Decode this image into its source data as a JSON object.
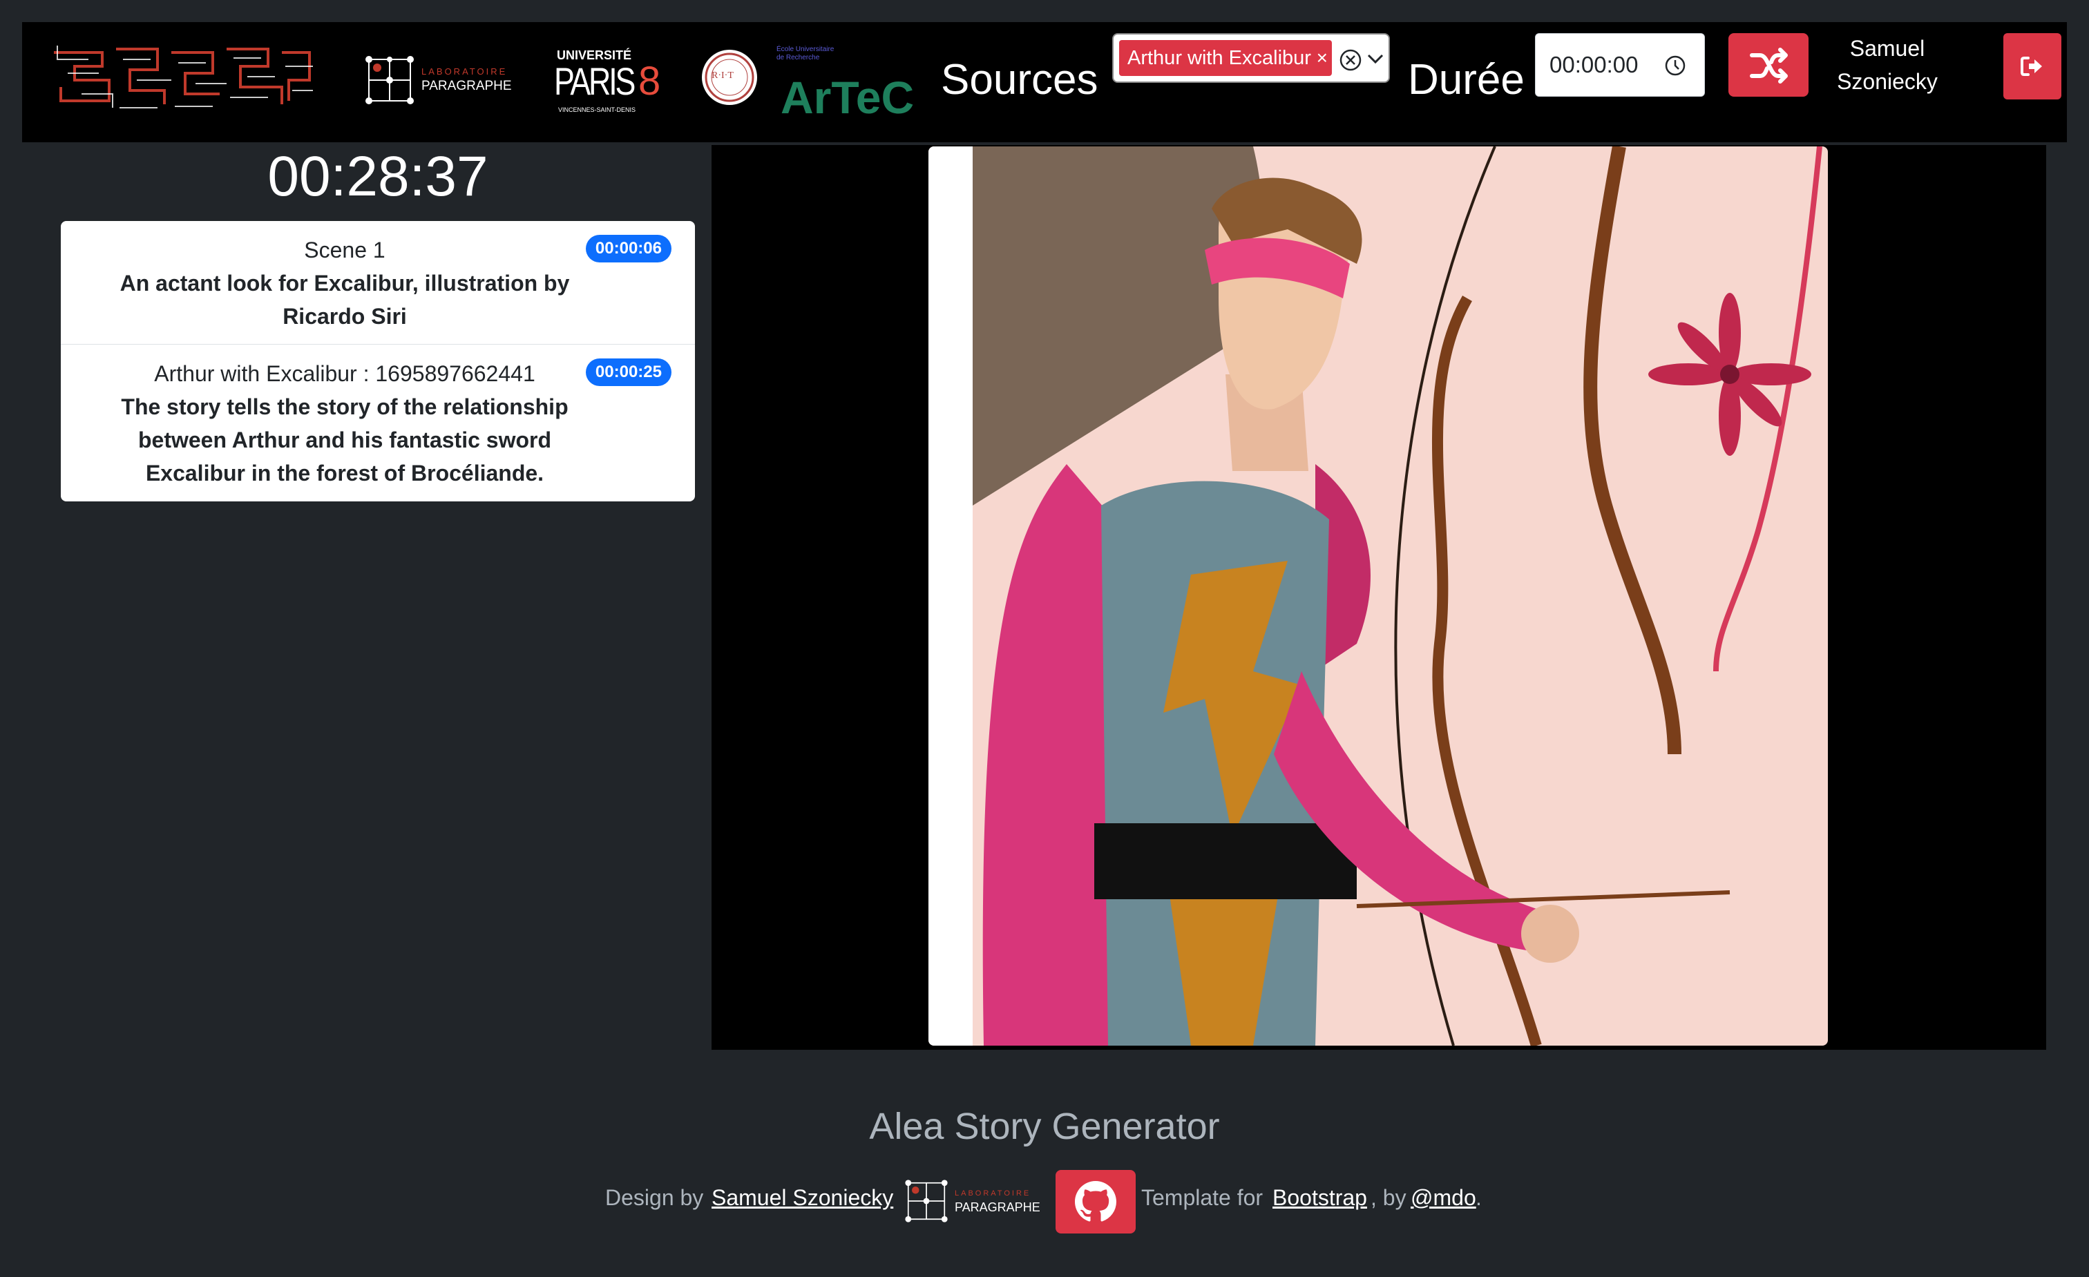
{
  "header": {
    "logos": {
      "paragraphe_small": "LABORATOIRE",
      "paragraphe": "PARAGRAPHE",
      "p8_top": "UNIVERSITÉ",
      "p8_main": "PARIS",
      "p8_num": "8",
      "p8_sub": "VINCENNES-SAINT-DENIS",
      "rit": "R·I·T",
      "artec_small": "École Universitaire de Recherche",
      "artec": "ArTeC"
    },
    "sources_label": "Sources",
    "sources_chip": "Arthur with Excalibur",
    "chip_remove": "×",
    "duree_label": "Durée",
    "duree_value": "00:00:00",
    "user_name_line1": "Samuel",
    "user_name_line2": "Szoniecky"
  },
  "timer": "00:28:37",
  "scenes": [
    {
      "title": "Scene 1",
      "desc": "An actant look for Excalibur, illustration by Ricardo Siri",
      "badge": "00:00:06"
    },
    {
      "title": "Arthur with Excalibur : 1695897662441",
      "desc": "The story tells the story of the relationship between Arthur and his fantastic sword Excalibur in the forest of Brocéliande.",
      "badge": "00:00:25"
    }
  ],
  "footer": {
    "title": "Alea Story Generator",
    "design_by": "Design by",
    "author": "Samuel Szoniecky",
    "para_small": "LABORATOIRE",
    "para": "PARAGRAPHE",
    "template_for": "Template for",
    "bootstrap": "Bootstrap",
    "by": ", by",
    "mdo": "@mdo",
    "dot": "."
  },
  "colors": {
    "accent_red": "#dc3545",
    "badge_blue": "#0d6efd",
    "background": "#212529"
  },
  "icons": [
    "shuffle-icon",
    "logout-icon",
    "clock-icon",
    "clear-circle-icon",
    "chevron-down-icon",
    "github-icon"
  ]
}
